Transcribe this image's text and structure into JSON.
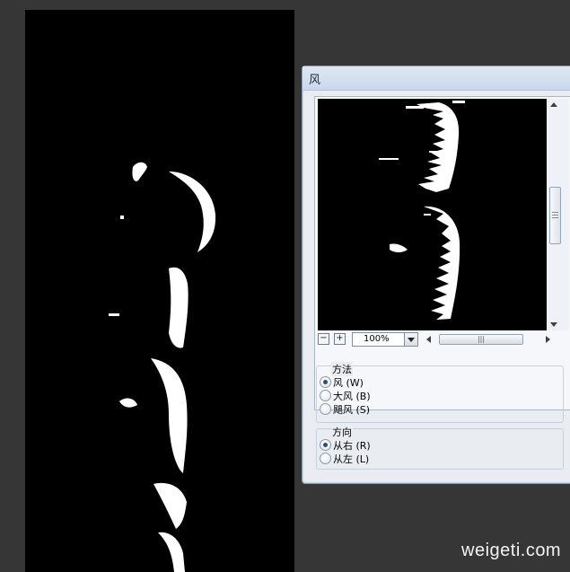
{
  "dialog": {
    "title": "风",
    "zoom_out_label": "−",
    "zoom_in_label": "+",
    "zoom_value": "100%"
  },
  "method_group": {
    "legend": "方法",
    "options": [
      {
        "label": "风 (W)",
        "checked": true
      },
      {
        "label": "大风 (B)",
        "checked": false
      },
      {
        "label": "飓风 (S)",
        "checked": false
      }
    ]
  },
  "direction_group": {
    "legend": "方向",
    "options": [
      {
        "label": "从右 (R)",
        "checked": true
      },
      {
        "label": "从左 (L)",
        "checked": false
      }
    ]
  },
  "watermark": "weigeti.com",
  "icons": {
    "zoom_out": "minus-icon",
    "zoom_in": "plus-icon",
    "dropdown": "chevron-down-icon",
    "scroll_up": "arrow-up-icon",
    "scroll_down": "arrow-down-icon",
    "scroll_left": "arrow-left-icon",
    "scroll_right": "arrow-right-icon"
  },
  "colors": {
    "workspace": "#363636",
    "dialog_bg": "#e9edf2",
    "canvas": "#000000",
    "shape": "#ffffff"
  }
}
